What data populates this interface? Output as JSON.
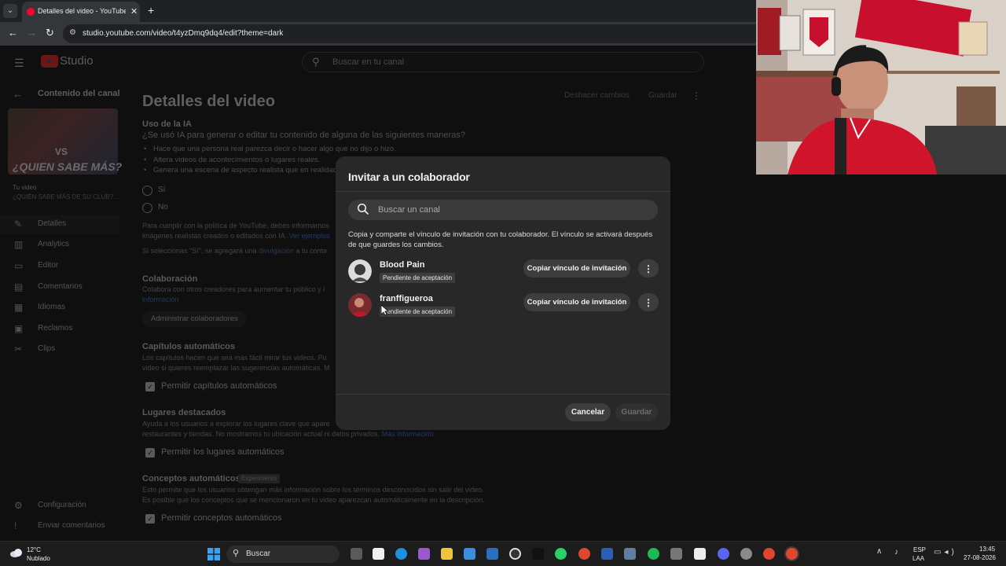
{
  "browser": {
    "tab_title": "Detalles del video - YouTube St",
    "tab_close": "✕",
    "new_tab": "+",
    "url": "studio.youtube.com/video/t4yzDmq9dq4/edit?theme=dark"
  },
  "studio": {
    "logo_text": "Studio",
    "search_placeholder": "Buscar en tu canal",
    "back_label": "Contenido del canal",
    "thumbnail_vs": "VS",
    "thumbnail_text": "¿QUIEN SABE MÁS?",
    "your_video_label": "Tu video",
    "video_subtitle": "¿QUIÉN SABE MÁS DE SU CLUB?...",
    "nav": [
      {
        "label": "Detalles",
        "icon": "pencil-icon"
      },
      {
        "label": "Analytics",
        "icon": "analytics-icon"
      },
      {
        "label": "Editor",
        "icon": "editor-icon"
      },
      {
        "label": "Comentarios",
        "icon": "comments-icon"
      },
      {
        "label": "Idiomas",
        "icon": "languages-icon"
      },
      {
        "label": "Reclamos",
        "icon": "copyright-icon"
      },
      {
        "label": "Clips",
        "icon": "clips-icon"
      }
    ],
    "settings_label": "Configuración",
    "feedback_label": "Enviar comentarios",
    "page_title": "Detalles del video",
    "top_button_1": "Deshacer cambios",
    "top_button_2": "Guardar",
    "ai_section": {
      "title": "Uso de la IA",
      "question": "¿Se usó IA para generar o editar tu contenido de alguna de las siguientes maneras?",
      "bullets": [
        "Hace que una persona real parezca decir o hacer algo que no dijo o hizo.",
        "Altera videos de acontecimientos o lugares reales.",
        "Genera una escena de aspecto realista que en realidad n"
      ],
      "yes": "Sí",
      "no": "No",
      "policy_text": "Para cumplir con la política de YouTube, debes informarnos",
      "policy_text_2": "imágenes realistas creados o editados con IA.",
      "policy_link": "Ver ejemplos",
      "disclosure_text": "Si seleccionas \"Sí\", se agregará una",
      "disclosure_link": "divulgación",
      "disclosure_tail": "a tu conte"
    },
    "collab_section": {
      "title": "Colaboración",
      "text": "Colabora con otros creadores para aumentar tu público y l",
      "link": "información",
      "button": "Administrar colaboradores"
    },
    "chapters": {
      "title": "Capítulos automáticos",
      "text": "Los capítulos hacen que sea más fácil mirar tus videos. Pu",
      "text2": "video si quieres reemplazar las sugerencias automáticas. M",
      "checkbox": "Permitir capítulos automáticos"
    },
    "places": {
      "title": "Lugares destacados",
      "text": "Ayuda a los usuarios a explorar los lugares clave que apare",
      "text2": "restaurantes y tiendas. No mostramos tu ubicación actual ni datos privados.",
      "link": "Más información",
      "checkbox": "Permitir los lugares automáticos"
    },
    "concepts": {
      "title": "Conceptos automáticos",
      "badge": "Experimento",
      "text": "Esto permite que los usuarios obtengan más información sobre los términos desconocidos sin salir del video.",
      "text2": "Es posible que los conceptos que se mencionaron en tu video aparezcan automáticamente en la descripción.",
      "checkbox": "Permitir conceptos automáticos"
    }
  },
  "dialog": {
    "title": "Invitar a un colaborador",
    "search_placeholder": "Buscar un canal",
    "description": "Copia y comparte el vínculo de invitación con tu colaborador. El vínculo se activará después de que guardes los cambios.",
    "collaborators": [
      {
        "name": "Blood Pain",
        "status": "Pendiente de aceptación",
        "copy_label": "Copiar vínculo de invitación"
      },
      {
        "name": "franffigueroa",
        "status": "Pendiente de aceptación",
        "copy_label": "Copiar vínculo de invitación"
      }
    ],
    "cancel_label": "Cancelar",
    "save_label": "Guardar"
  },
  "taskbar": {
    "temperature": "12°C",
    "weather": "Nublado",
    "search_label": "Buscar",
    "lang_1": "ESP",
    "lang_2": "LAA",
    "time": "13:45",
    "date": "27-08-2026"
  },
  "colors": {
    "dialog_bg": "#282828",
    "page_bg": "#0f0f0f",
    "chip_bg": "#3d3d3d",
    "brand_red": "#ff0033"
  }
}
